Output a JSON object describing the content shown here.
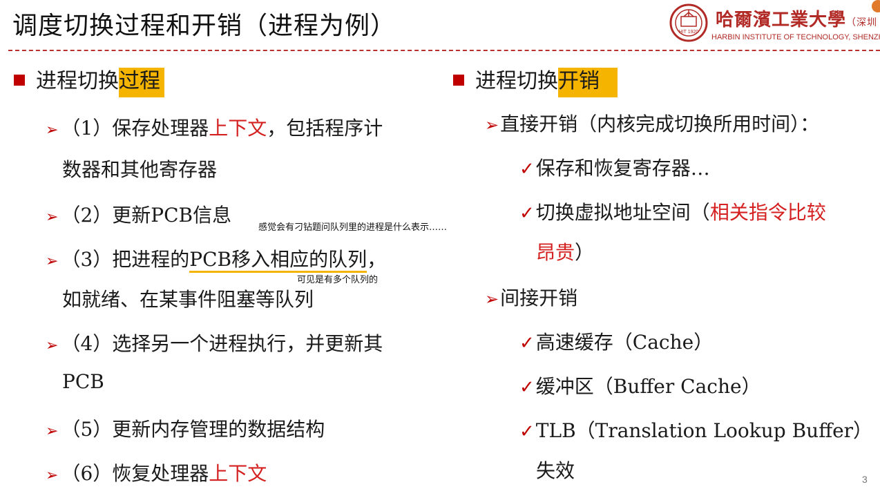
{
  "title": "调度切换过程和开销（进程为例）",
  "logo": {
    "name_cn": "哈爾濱工業大學",
    "campus_cn": "（深圳",
    "name_en": "HARBIN INSTITUTE OF TECHNOLOGY, SHENZHEN",
    "seal_text": "HIT 1920"
  },
  "left": {
    "heading_prefix": "进程切换",
    "heading_highlight": "过程",
    "items": {
      "i1_a": "（1）保存处理器",
      "i1_red": "上下文",
      "i1_b": "，包括程序计",
      "i1_c": "数器和其他寄存器",
      "i2": "（2）更新PCB信息",
      "i3_a": "（3）把进程的",
      "i3_u": "PCB移入相应的队列",
      "i3_b": "，",
      "i3_c": "如就绪、在某事件阻塞等队列",
      "i4_a": "（4）选择另一个进程执行，并更新其",
      "i4_b": "PCB",
      "i5": "（5）更新内存管理的数据结构",
      "i6_a": "（6）恢复处理器",
      "i6_red": "上下文"
    },
    "notes": {
      "n1": "感觉会有刁钻题问队列里的进程是什么表示……",
      "n2": "可见是有多个队列的"
    }
  },
  "right": {
    "heading_prefix": "进程切换",
    "heading_highlight": "开销",
    "direct": "直接开销（内核完成切换所用时间）：",
    "d1": "保存和恢复寄存器…",
    "d2_a": "切换虚拟地址空间（",
    "d2_red": "相关指令比较",
    "d2_red2": "昂贵",
    "d2_b": "）",
    "indirect": "间接开销",
    "c1": "高速缓存（Cache）",
    "c2": "缓冲区（Buffer Cache）",
    "c3": "TLB（Translation Lookup Buffer）",
    "c3_b": "失效"
  },
  "page_number": "3",
  "colors": {
    "accent_red": "#c00000",
    "highlight": "#f5b400",
    "logo_red": "#b22a26"
  },
  "icons": {
    "bullet": "square",
    "arrow": "right-arrowhead",
    "check": "checkmark"
  }
}
